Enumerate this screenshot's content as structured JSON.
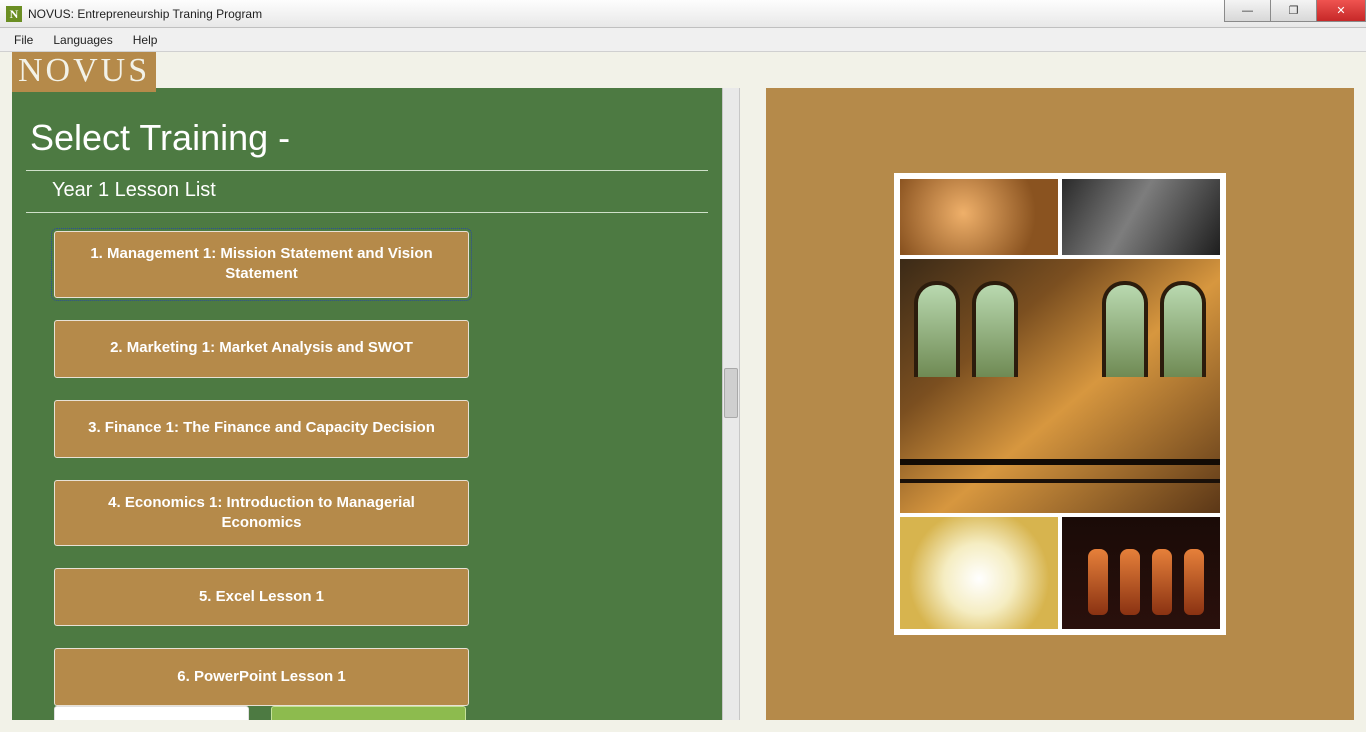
{
  "window": {
    "title": "NOVUS: Entrepreneurship Traning Program"
  },
  "menubar": {
    "file": "File",
    "languages": "Languages",
    "help": "Help"
  },
  "branding": {
    "logo_text": "NOVUS"
  },
  "main": {
    "heading": "Select Training -",
    "subheading": "Year 1 Lesson List",
    "lessons": [
      {
        "label": "1. Management 1: Mission Statement and Vision Statement",
        "selected": true
      },
      {
        "label": "2. Marketing 1: Market Analysis and SWOT",
        "selected": false
      },
      {
        "label": "3. Finance 1: The Finance and Capacity Decision",
        "selected": false
      },
      {
        "label": "4. Economics 1: Introduction to Managerial Economics",
        "selected": false
      },
      {
        "label": "5. Excel Lesson 1",
        "selected": false
      },
      {
        "label": "6. PowerPoint Lesson 1",
        "selected": false
      }
    ]
  },
  "preview": {
    "tiles": [
      "copper-vats",
      "machinery",
      "brewery-hall",
      "beer-glass",
      "bottles"
    ]
  }
}
